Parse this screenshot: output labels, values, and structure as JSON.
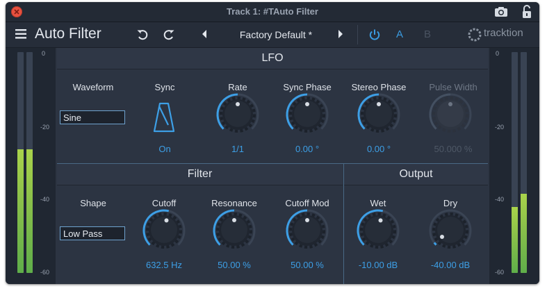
{
  "window": {
    "title": "Track 1: #TAuto Filter"
  },
  "toolbar": {
    "plugin_name": "Auto Filter",
    "preset_name": "Factory Default *",
    "ab_a": "A",
    "ab_b": "B",
    "brand": "tracktion"
  },
  "meters": {
    "left": {
      "scale": [
        "0",
        "-20",
        "-40",
        "-60"
      ],
      "levels": [
        0.56,
        0.56
      ]
    },
    "right": {
      "scale": [
        "0",
        "-20",
        "-40",
        "-60"
      ],
      "levels": [
        0.3,
        0.36
      ]
    }
  },
  "lfo": {
    "title": "LFO",
    "waveform": {
      "label": "Waveform",
      "value": "Sine"
    },
    "sync": {
      "label": "Sync",
      "value": "On"
    },
    "rate": {
      "label": "Rate",
      "value": "1/1",
      "position": 0.5
    },
    "sync_phase": {
      "label": "Sync Phase",
      "value": "0.00 °",
      "position": 0.5
    },
    "stereo_phase": {
      "label": "Stereo Phase",
      "value": "0.00 °",
      "position": 0.5
    },
    "pulse_width": {
      "label": "Pulse Width",
      "value": "50.000 %",
      "position": 0.5,
      "disabled": true
    }
  },
  "filter": {
    "title": "Filter",
    "shape": {
      "label": "Shape",
      "value": "Low Pass"
    },
    "cutoff": {
      "label": "Cutoff",
      "value": "632.5 Hz",
      "position": 0.55
    },
    "resonance": {
      "label": "Resonance",
      "value": "50.00 %",
      "position": 0.5
    },
    "cutoff_mod": {
      "label": "Cutoff Mod",
      "value": "50.00 %",
      "position": 0.5
    }
  },
  "output": {
    "title": "Output",
    "wet": {
      "label": "Wet",
      "value": "-10.00 dB",
      "position": 0.55
    },
    "dry": {
      "label": "Dry",
      "value": "-40.00 dB",
      "position": 0.03
    }
  },
  "colors": {
    "accent": "#3d9fe6",
    "panel": "#2c3442",
    "meter_fill": "#8cc14a"
  }
}
